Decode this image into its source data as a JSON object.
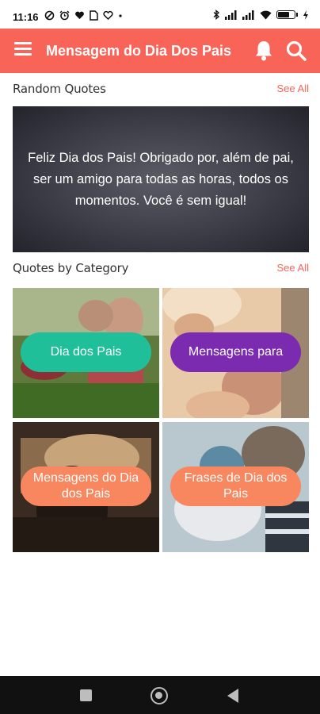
{
  "status_bar": {
    "time": "11:16",
    "battery_level": 0.75,
    "icons": [
      "data-saver-icon",
      "alarm-icon",
      "heart-icon",
      "sim-icon",
      "heart-pulse-icon",
      "dot-icon",
      "bluetooth-icon",
      "signal-icon",
      "signal-icon",
      "wifi-icon",
      "battery-icon",
      "charging-icon"
    ]
  },
  "app_bar": {
    "title": "Mensagem do Dia Dos Pais",
    "color": "#f96459"
  },
  "random_quotes": {
    "title": "Random Quotes",
    "see_all": "See All",
    "quote": "Feliz Dia dos Pais! Obrigado por, além de pai, ser um amigo para todas as horas, todos os momentos. Você é sem igual!"
  },
  "categories": {
    "title": "Quotes by Category",
    "see_all": "See All",
    "items": [
      {
        "label": "Dia dos Pais",
        "color": "#1fbf9a"
      },
      {
        "label": "Mensagens para",
        "color": "#7b2bb0"
      },
      {
        "label": "Mensagens do Dia dos Pais",
        "color": "#f8875f"
      },
      {
        "label": "Frases de Dia dos Pais",
        "color": "#f8875f"
      }
    ]
  }
}
